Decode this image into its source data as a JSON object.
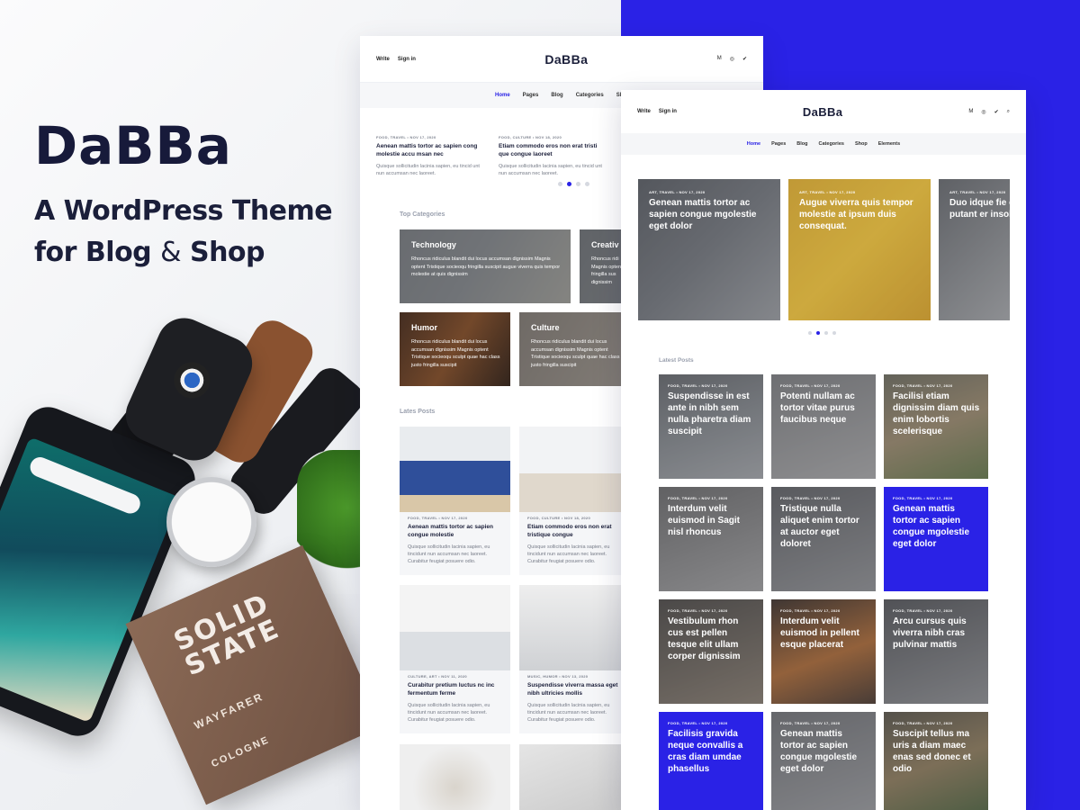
{
  "brand": {
    "name": "DaBBa",
    "tagline_line1": "A WordPress Theme",
    "tagline_for": "for",
    "tagline_blog": "Blog",
    "tagline_amp": "&",
    "tagline_shop": "Shop"
  },
  "product_box": {
    "title": "SOLID STATE",
    "subtitle": "WAYFARER",
    "line": "COLOGNE"
  },
  "colors": {
    "accent": "#2a22e6",
    "dark": "#1b1f3a"
  },
  "screen1": {
    "header": {
      "write": "Write",
      "signin": "Sign in",
      "logo": "DaBBa",
      "social": [
        "M",
        "◎",
        "✔"
      ]
    },
    "nav": [
      "Home",
      "Pages",
      "Blog",
      "Categories",
      "Shop"
    ],
    "featured": [
      {
        "meta": "FOOD, TRAVEL • NOV 17, 2020",
        "title": "Aenean mattis tortor ac sapien cong molestie accu msan nec",
        "excerpt": "Quisque sollicitudin lacinia sapien, eu tincid unt nun accumsan nec laoreet."
      },
      {
        "meta": "FOOD, CULTURE • NOV 18, 2020",
        "title": "Etiam commodo eros non erat tristi que congue laoreet",
        "excerpt": "Quisque sollicitudin lacinia sapien, eu tincid unt nun accumsan nec laoreet."
      }
    ],
    "top_categories_heading": "Top Categories",
    "categories": [
      {
        "name": "Technology",
        "desc": "Rhoncus ridiculus blandit dui locus accumsan dignissim Magnis optent Tristique socieoqu fringilla suscipit augue viverra quis tempor molestie at quis dignissim"
      },
      {
        "name": "Creativ",
        "desc": "Rhoncus ridi Magnis opten fringilla sus dignissim"
      },
      {
        "name": "Humor",
        "desc": "Rhoncus ridiculus blandit dui locus accumsan dignissim Magnis optent Tristique socieoqu sculpt quae hac class justo fringilla suscipit"
      },
      {
        "name": "Culture",
        "desc": "Rhoncus ridiculus blandit dui locus accumsan dignissim Magnis optent Tristique socieoqu sculpt quae hac class justo fringilla suscipit"
      }
    ],
    "latest_heading": "Lates Posts",
    "latest": [
      {
        "meta": "FOOD, TRAVEL • NOV 17, 2020",
        "title": "Aenean mattis tortor ac sapien congue molestie",
        "l1": "Quisque sollicitudin lacinia sapien, eu",
        "l2": "tincidunt nun accumsan nec laoreet.",
        "l3": "Curabitur feugiat posuere odio."
      },
      {
        "meta": "FOOD, CULTURE • NOV 18, 2020",
        "title": "Etiam commodo eros non erat tristique congue",
        "l1": "Quisque sollicitudin lacinia sapien, eu",
        "l2": "tincidunt nun accumsan nec laoreet.",
        "l3": "Curabitur feugiat posuere odio."
      },
      {
        "meta": "CULTURE, ART • NOV 11, 2020",
        "title": "Curabitur pretium luctus nc inc fermentum ferme",
        "l1": "Quisque sollicitudin lacinia sapien, eu",
        "l2": "tincidunt nun accumsan nec laoreet.",
        "l3": "Curabitur feugiat posuere odio."
      },
      {
        "meta": "MUSIC, HUMOR • NOV 13, 2020",
        "title": "Suspendisse viverra massa eget nibh ultricies mollis",
        "l1": "Quisque sollicitudin lacinia sapien, eu",
        "l2": "tincidunt nun accumsan nec laoreet.",
        "l3": "Curabitur feugiat posuere odio."
      }
    ]
  },
  "screen2": {
    "header": {
      "write": "Write",
      "signin": "Sign in",
      "logo": "DaBBa",
      "social": [
        "M",
        "◎",
        "✔",
        "⌕"
      ]
    },
    "nav": [
      "Home",
      "Pages",
      "Blog",
      "Categories",
      "Shop",
      "Elements"
    ],
    "slides": [
      {
        "meta": "ART, TRAVEL • NOV 17, 2020",
        "title": "Genean mattis tortor ac sapien congue mgolestie eget dolor"
      },
      {
        "meta": "ART, TRAVEL • NOV 17, 2020",
        "title": "Augue viverra quis tempor molestie at ipsum duis consequat."
      },
      {
        "meta": "ART, TRAVEL • NOV 17, 2020",
        "title": "Duo idque fie ea putant er insolens"
      }
    ],
    "latest_heading": "Latest Posts",
    "tiles": [
      {
        "meta": "FOOD, TRAVEL • NOV 17, 2020",
        "title": "Suspendisse in est ante in nibh sem nulla pharetra diam suscipit"
      },
      {
        "meta": "FOOD, TRAVEL • NOV 17, 2020",
        "title": "Potenti nullam ac tortor vitae purus faucibus neque"
      },
      {
        "meta": "FOOD, TRAVEL • NOV 17, 2020",
        "title": "Facilisi etiam dignissim diam quis enim lobortis scelerisque"
      },
      {
        "meta": "FOOD, TRAVEL • NOV 17, 2020",
        "title": "Interdum velit euismod in Sagit nisl rhoncus"
      },
      {
        "meta": "FOOD, TRAVEL • NOV 17, 2020",
        "title": "Tristique nulla aliquet enim tortor at auctor eget doloret"
      },
      {
        "meta": "FOOD, TRAVEL • NOV 17, 2020",
        "title": "Genean mattis tortor ac sapien congue mgolestie eget dolor"
      },
      {
        "meta": "FOOD, TRAVEL • NOV 17, 2020",
        "title": "Vestibulum rhon cus est pellen tesque elit ullam corper dignissim"
      },
      {
        "meta": "FOOD, TRAVEL • NOV 17, 2020",
        "title": "Interdum velit euismod in pellent esque placerat"
      },
      {
        "meta": "FOOD, TRAVEL • NOV 17, 2020",
        "title": "Arcu cursus quis viverra nibh cras pulvinar mattis"
      },
      {
        "meta": "FOOD, TRAVEL • NOV 17, 2020",
        "title": "Facilisis gravida neque convallis a cras diam umdae phasellus"
      },
      {
        "meta": "FOOD, TRAVEL • NOV 17, 2020",
        "title": "Genean mattis tortor ac sapien congue mgolestie eget dolor"
      },
      {
        "meta": "FOOD, TRAVEL • NOV 17, 2020",
        "title": "Suscipit tellus ma uris a diam maec enas sed donec et odio"
      }
    ]
  }
}
